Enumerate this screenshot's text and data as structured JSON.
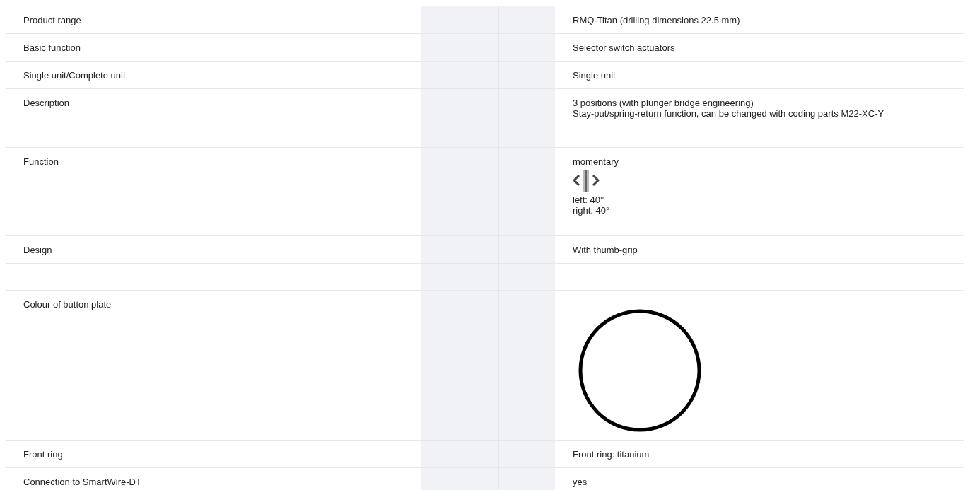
{
  "rows": [
    {
      "label": "Product range",
      "value": [
        {
          "kind": "text",
          "text": "RMQ-Titan (drilling dimensions 22.5 mm)"
        }
      ]
    },
    {
      "label": "Basic function",
      "value": [
        {
          "kind": "text",
          "text": "Selector switch actuators"
        }
      ]
    },
    {
      "label": "Single unit/Complete unit",
      "value": [
        {
          "kind": "text",
          "text": "Single unit"
        }
      ]
    },
    {
      "label": "Description",
      "value": [
        {
          "kind": "text",
          "text": "3 positions (with plunger bridge engineering)"
        },
        {
          "kind": "text",
          "text": "Stay-put/spring-return function, can be changed with coding parts M22-XC-Y"
        }
      ]
    },
    {
      "label": "Function",
      "value": [
        {
          "kind": "text",
          "text": "momentary"
        },
        {
          "kind": "symbol"
        },
        {
          "kind": "text",
          "text": "left: 40°"
        },
        {
          "kind": "text",
          "text": "right: 40°"
        }
      ]
    },
    {
      "label": "Design",
      "value": [
        {
          "kind": "text",
          "text": "With thumb-grip"
        }
      ]
    },
    {
      "label": "",
      "value": []
    },
    {
      "label": "Colour of button plate",
      "value": [
        {
          "kind": "plate"
        }
      ]
    },
    {
      "label": "Front ring",
      "value": [
        {
          "kind": "text",
          "text": "Front ring: titanium"
        }
      ]
    },
    {
      "label": "Connection to SmartWire-DT",
      "value": [
        {
          "kind": "text",
          "text": "yes"
        }
      ]
    }
  ]
}
